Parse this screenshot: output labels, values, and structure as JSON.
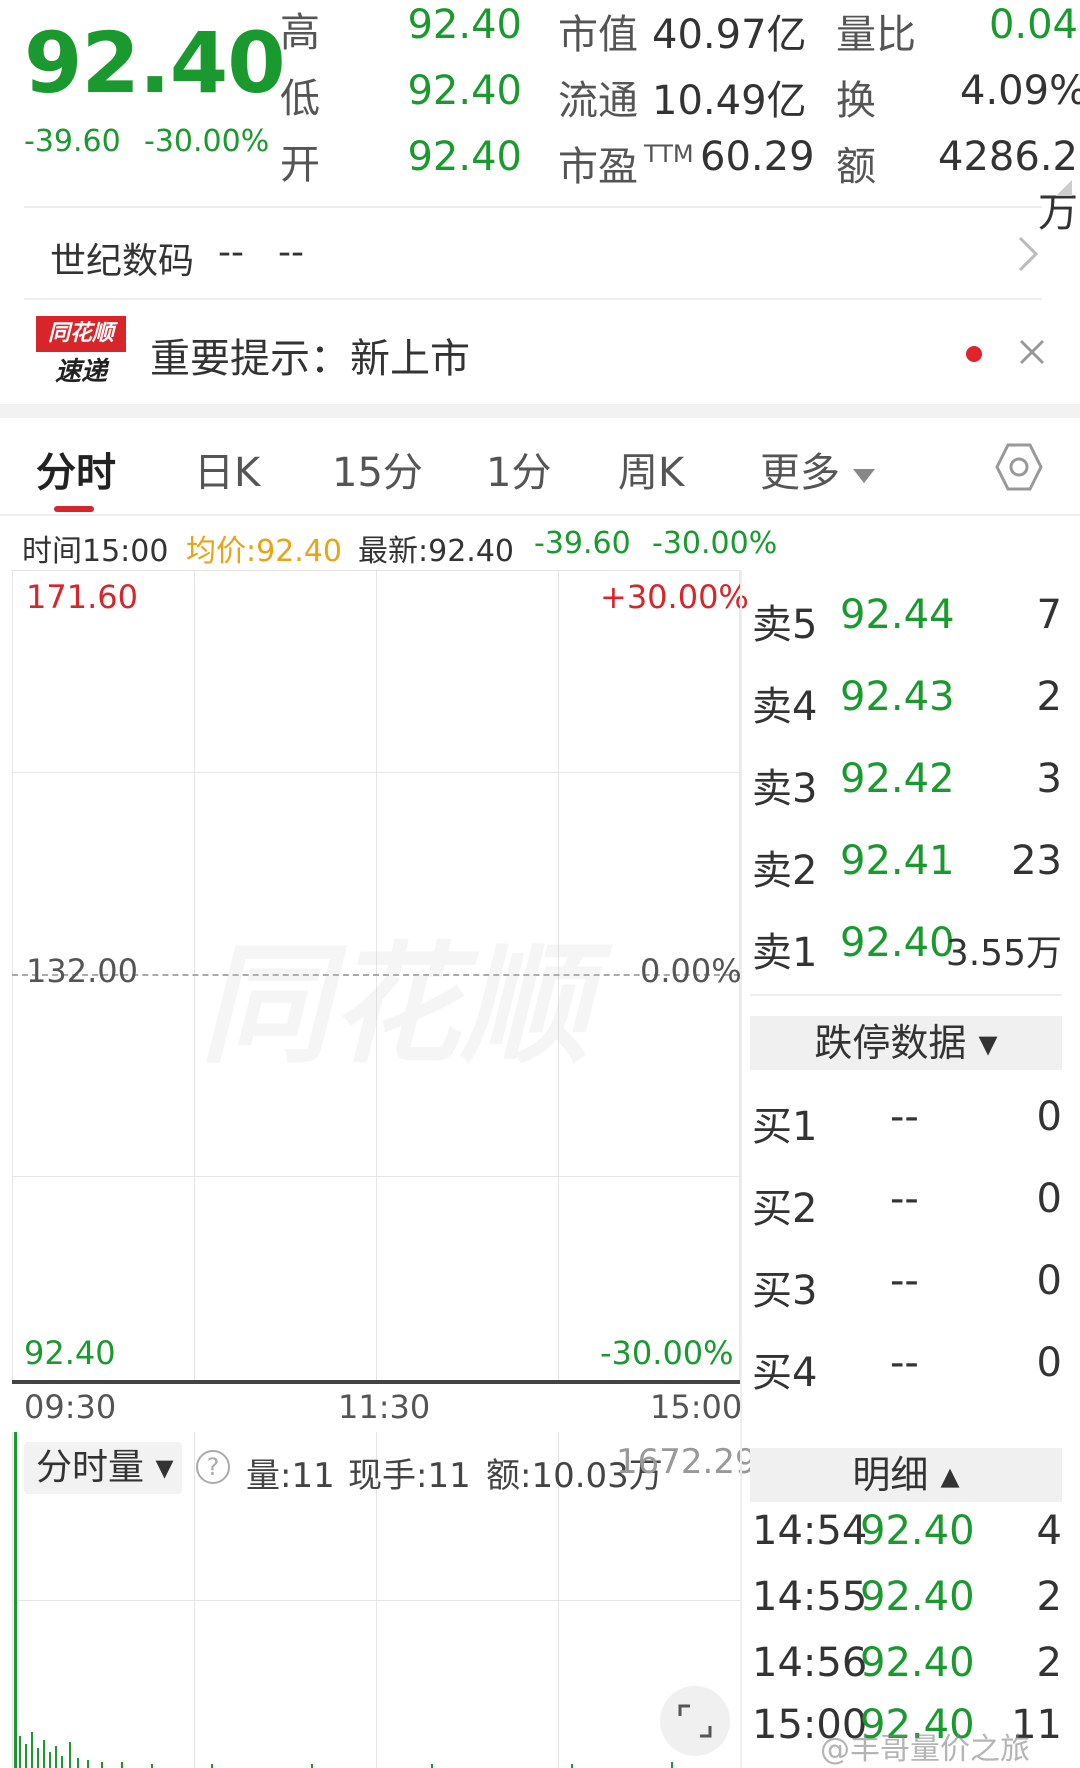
{
  "quote": {
    "price": "92.40",
    "change": "-39.60",
    "change_pct": "-30.00%",
    "high_label": "高",
    "high": "92.40",
    "low_label": "低",
    "low": "92.40",
    "open_label": "开",
    "open": "92.40",
    "mktcap_label": "市值",
    "mktcap": "40.97亿",
    "float_label": "流通",
    "float": "10.49亿",
    "pe_label": "市盈",
    "pe_sup": "TTM",
    "pe": "60.29",
    "volratio_label": "量比",
    "volratio": "0.04",
    "turnover_label": "换",
    "turnover": "4.09%",
    "amount_label": "额",
    "amount": "4286.2万"
  },
  "company_row": {
    "name": "世纪数码",
    "value1": "--",
    "value2": "--"
  },
  "news": {
    "logo_line1": "同花顺",
    "logo_line2": "速递",
    "text": "重要提示：新上市"
  },
  "tabs": [
    {
      "label": "分时",
      "active": true
    },
    {
      "label": "日K"
    },
    {
      "label": "15分"
    },
    {
      "label": "1分"
    },
    {
      "label": "周K"
    },
    {
      "label": "更多"
    }
  ],
  "infobar": {
    "time": "时间15:00",
    "avg": "均价:92.40",
    "latest": "最新:92.40",
    "change": "-39.60",
    "change_pct": "-30.00%"
  },
  "chart": {
    "top_price": "171.60",
    "top_pct": "+30.00%",
    "mid_price": "132.00",
    "mid_pct": "0.00%",
    "bottom_price": "92.40",
    "bottom_pct": "-30.00%",
    "times": [
      "09:30",
      "11:30",
      "15:00"
    ],
    "watermark": "同花顺"
  },
  "sell_orders": [
    {
      "label": "卖5",
      "price": "92.44",
      "vol": "7"
    },
    {
      "label": "卖4",
      "price": "92.43",
      "vol": "2"
    },
    {
      "label": "卖3",
      "price": "92.42",
      "vol": "3"
    },
    {
      "label": "卖2",
      "price": "92.41",
      "vol": "23"
    },
    {
      "label": "卖1",
      "price": "92.40",
      "vol": "3.55万"
    }
  ],
  "limit_section": "跌停数据 ▾",
  "buy_orders": [
    {
      "label": "买1",
      "price": "--",
      "vol": "0"
    },
    {
      "label": "买2",
      "price": "--",
      "vol": "0"
    },
    {
      "label": "买3",
      "price": "--",
      "vol": "0"
    },
    {
      "label": "买4",
      "price": "--",
      "vol": "0"
    }
  ],
  "volume_panel": {
    "selector": "分时量 ▾",
    "help": "?",
    "vol": "量:11",
    "current": "现手:11",
    "amount": "额:10.03万",
    "max": "1672.29"
  },
  "detail_section": "明细 ▴",
  "details": [
    {
      "time": "14:54",
      "price": "92.40",
      "vol": "4"
    },
    {
      "time": "14:55",
      "price": "92.40",
      "vol": "2"
    },
    {
      "time": "14:56",
      "price": "92.40",
      "vol": "2"
    },
    {
      "time": "15:00",
      "price": "92.40",
      "vol": "11"
    }
  ],
  "footer_watermark": "@丰哥量价之旅"
}
